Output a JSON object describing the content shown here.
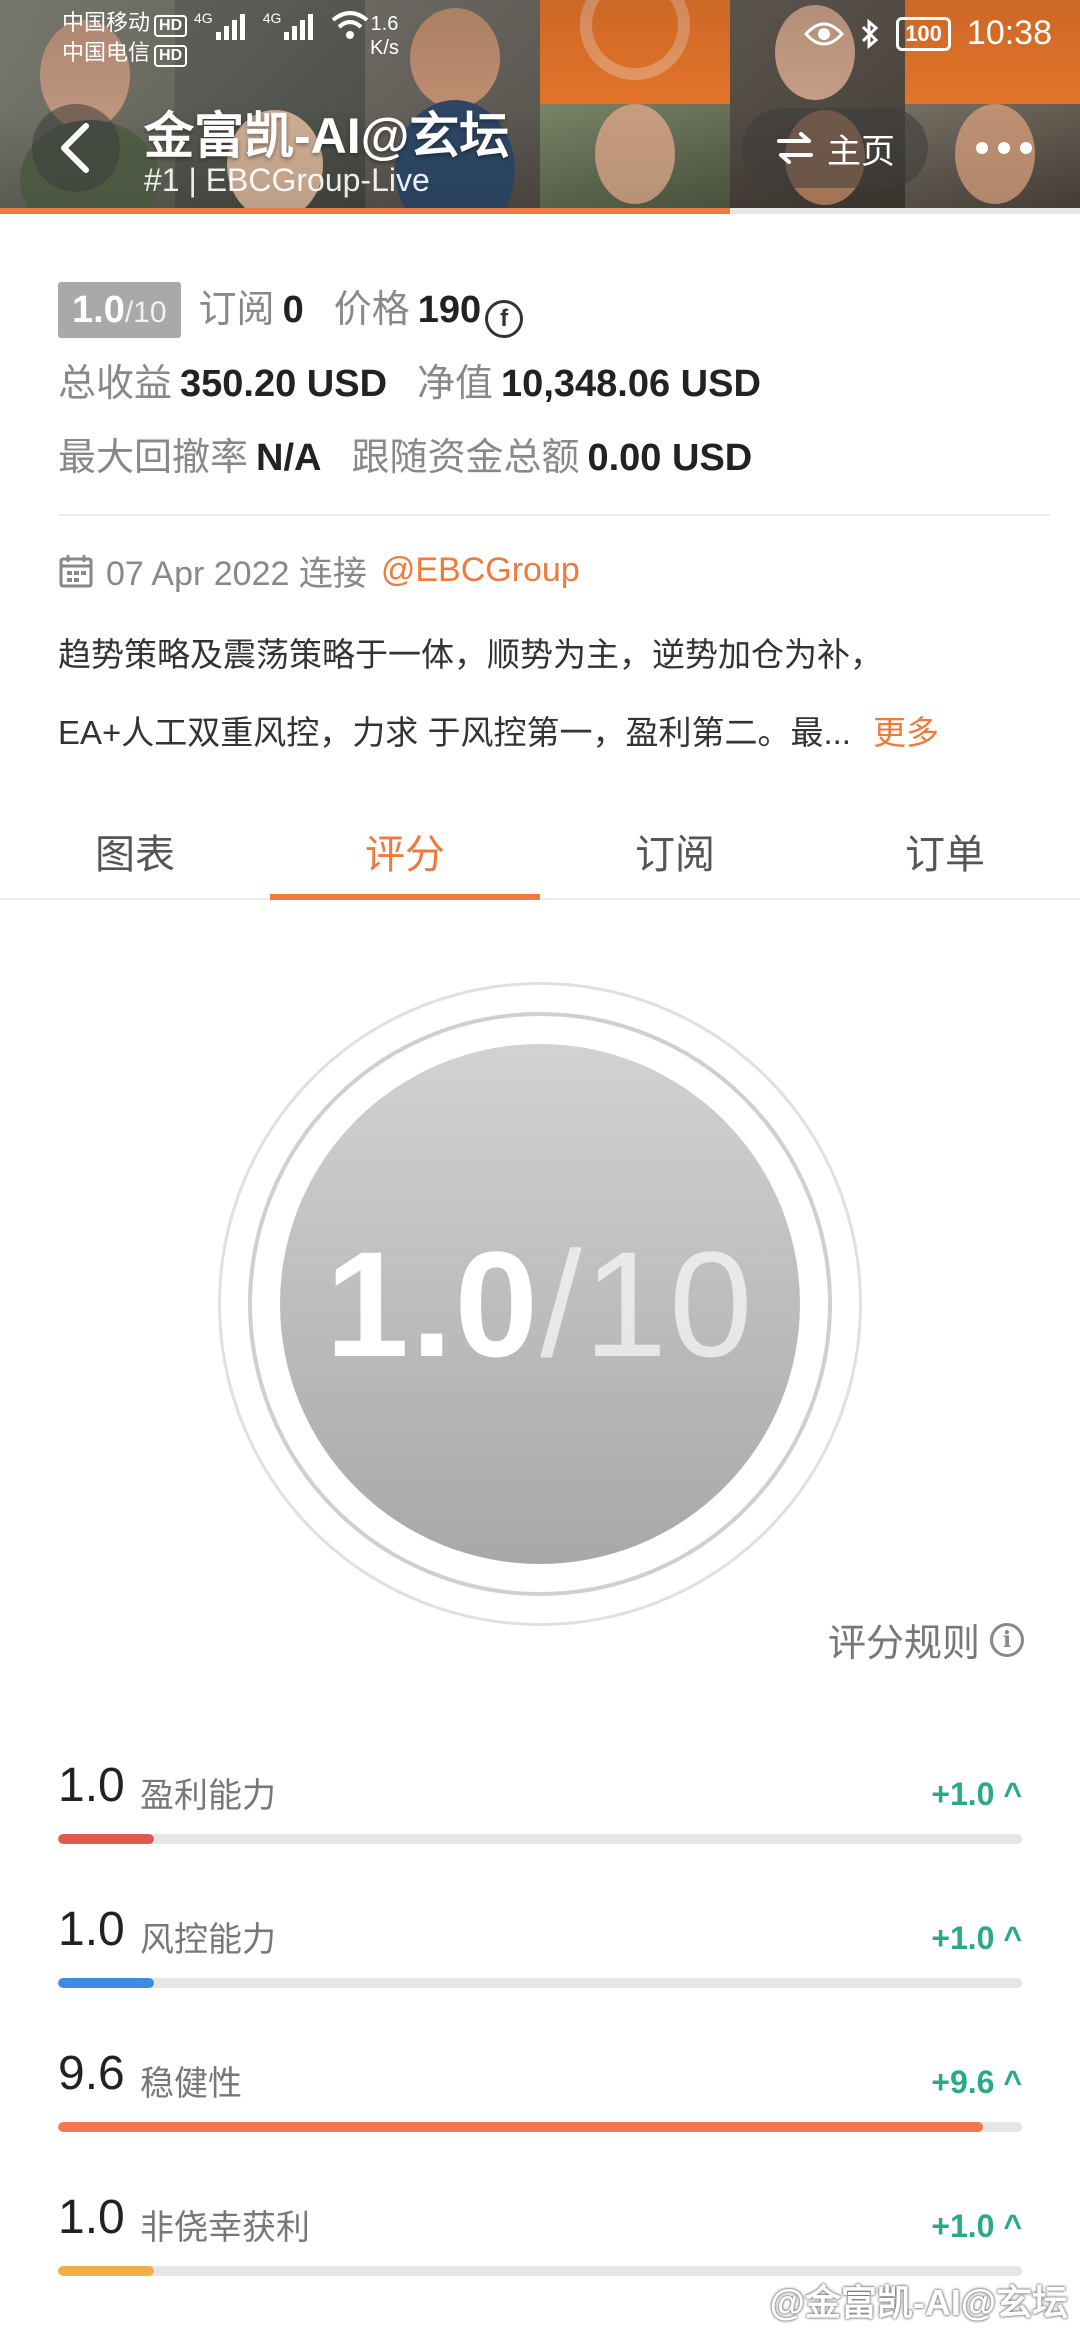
{
  "status_bar": {
    "carrier1": "中国移动",
    "carrier2": "中国电信",
    "hd": "HD",
    "net1": "4G",
    "net2": "4G",
    "speed_value": "1.6",
    "speed_unit": "K/s",
    "battery": "100",
    "time": "10:38"
  },
  "header": {
    "title": "金富凯-AI@玄坛",
    "subtitle": "#1 | EBCGroup-Live",
    "home_label": "主页",
    "colors": {
      "accent": "#f07a3c"
    }
  },
  "stats": {
    "rating_num": "1.0",
    "rating_den": "/10",
    "subscribe_label": "订阅",
    "subscribe_value": "0",
    "price_label": "价格",
    "price_value": "190",
    "total_profit_label": "总收益",
    "total_profit_value": "350.20 USD",
    "net_value_label": "净值",
    "net_value_value": "10,348.06 USD",
    "max_drawdown_label": "最大回撤率",
    "max_drawdown_value": "N/A",
    "follow_funds_label": "跟随资金总额",
    "follow_funds_value": "0.00 USD"
  },
  "meta": {
    "date": "07 Apr 2022 连接",
    "broker": "@EBCGroup"
  },
  "description": {
    "line1": "趋势策略及震荡策略于一体，顺势为主，逆势加仓为补，",
    "line2": "EA+人工双重风控，力求 于风控第一，盈利第二。最...",
    "more": "更多"
  },
  "tabs": [
    {
      "label": "图表",
      "active": false
    },
    {
      "label": "评分",
      "active": true
    },
    {
      "label": "订阅",
      "active": false
    },
    {
      "label": "订单",
      "active": false
    }
  ],
  "score": {
    "value": "1.0",
    "denominator": "/10",
    "rules_label": "评分规则"
  },
  "metrics": [
    {
      "value": "1.0",
      "label": "盈利能力",
      "delta": "+1.0",
      "fraction": 0.1,
      "color": "#e05a50"
    },
    {
      "value": "1.0",
      "label": "风控能力",
      "delta": "+1.0",
      "fraction": 0.1,
      "color": "#3f8be0"
    },
    {
      "value": "9.6",
      "label": "稳健性",
      "delta": "+9.6",
      "fraction": 0.96,
      "color": "#f07a4c"
    },
    {
      "value": "1.0",
      "label": "非侥幸获利",
      "delta": "+1.0",
      "fraction": 0.1,
      "color": "#f2ae4a"
    }
  ],
  "watermark": "@金富凯-AI@玄坛"
}
